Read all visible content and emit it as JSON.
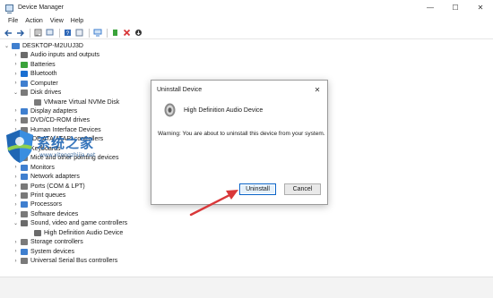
{
  "window": {
    "title": "Device Manager",
    "controls": {
      "minimize": "—",
      "maximize": "☐",
      "close": "✕"
    }
  },
  "menu": [
    "File",
    "Action",
    "View",
    "Help"
  ],
  "toolbar": {
    "icons": [
      "back-icon",
      "forward-icon",
      "properties-icon",
      "help-icon",
      "scan-icon",
      "update-driver-icon",
      "monitor-icon",
      "add-driver-icon",
      "uninstall-icon",
      "disable-icon"
    ]
  },
  "tree": {
    "root": "DESKTOP-M2UUJ3D",
    "items": [
      {
        "label": "Audio inputs and outputs",
        "color": "#6b6b6b"
      },
      {
        "label": "Batteries",
        "color": "#3aa33a"
      },
      {
        "label": "Bluetooth",
        "color": "#1a6fd1"
      },
      {
        "label": "Computer",
        "color": "#3f7fcf"
      },
      {
        "label": "Disk drives",
        "color": "#7a7a7a"
      },
      {
        "label": "VMware Virtual NVMe Disk",
        "color": "#7a7a7a"
      },
      {
        "label": "Display adapters",
        "color": "#3f7fcf"
      },
      {
        "label": "DVD/CD-ROM drives",
        "color": "#7a7a7a"
      },
      {
        "label": "Human Interface Devices",
        "color": "#7a7a7a"
      },
      {
        "label": "IDE ATA/ATAPI controllers",
        "color": "#7a7a7a"
      },
      {
        "label": "Keyboards",
        "color": "#7a7a7a"
      },
      {
        "label": "Mice and other pointing devices",
        "color": "#7a7a7a"
      },
      {
        "label": "Monitors",
        "color": "#3f7fcf"
      },
      {
        "label": "Network adapters",
        "color": "#3f7fcf"
      },
      {
        "label": "Ports (COM & LPT)",
        "color": "#7a7a7a"
      },
      {
        "label": "Print queues",
        "color": "#7a7a7a"
      },
      {
        "label": "Processors",
        "color": "#3f7fcf"
      },
      {
        "label": "Software devices",
        "color": "#7a7a7a"
      },
      {
        "label": "Sound, video and game controllers",
        "color": "#6b6b6b"
      },
      {
        "label": "High Definition Audio Device",
        "color": "#6b6b6b"
      },
      {
        "label": "Storage controllers",
        "color": "#7a7a7a"
      },
      {
        "label": "System devices",
        "color": "#3f7fcf"
      },
      {
        "label": "Universal Serial Bus controllers",
        "color": "#7a7a7a"
      }
    ]
  },
  "watermark": {
    "text": "系统之家",
    "url": "www.xitongzhijia.net"
  },
  "dialog": {
    "title": "Uninstall Device",
    "device_name": "High Definition Audio Device",
    "warning": "Warning: You are about to uninstall this device from your system.",
    "uninstall_label": "Uninstall",
    "cancel_label": "Cancel"
  },
  "colors": {
    "accent": "#0a64c8",
    "arrow": "#d9383a"
  }
}
